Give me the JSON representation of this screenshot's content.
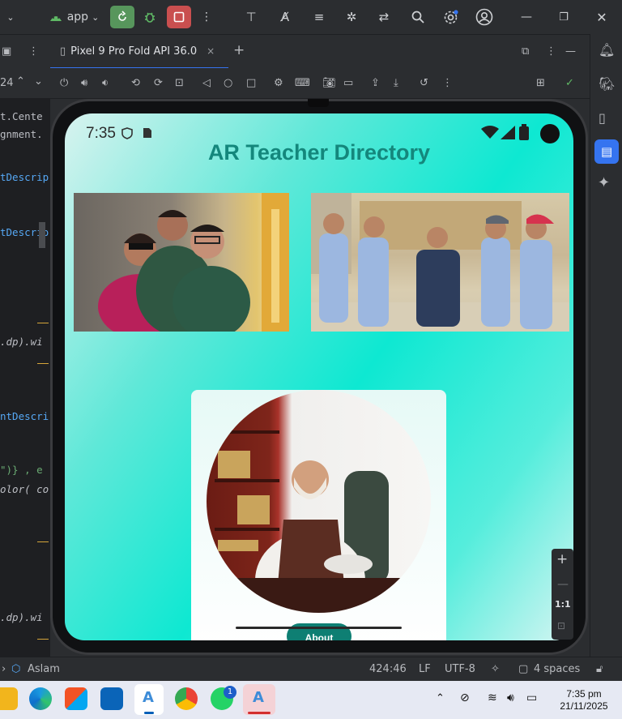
{
  "toolbar": {
    "run_config": "app",
    "icons": [
      "app-icon",
      "sync-icon",
      "debug-icon",
      "stop-icon",
      "more-icon",
      "tree-icon",
      "translate-icon",
      "logcat-icon",
      "bug-icon",
      "compare-icon",
      "search-icon",
      "settings-icon",
      "account-icon",
      "minimize-icon",
      "restore-icon",
      "close-icon"
    ]
  },
  "left_panel": {
    "zoom_value": "24"
  },
  "emulator": {
    "tab_label": "Pixel 9 Pro Fold API 36.0",
    "tab_close": "×",
    "add_tab": "+"
  },
  "code_fragments": [
    "t.Cente",
    "gnment.",
    "tDescrip",
    "tDescrip",
    ".dp).wi",
    "ntDescri",
    "\")} , e",
    "olor( co",
    ".dp).wi"
  ],
  "device": {
    "status_time": "7:35",
    "app_title": "AR Teacher Directory",
    "about_button": "About",
    "zoom_reset": "1:1",
    "zoom_in": "+"
  },
  "statusbar": {
    "project": "Aslam",
    "position": "424:46",
    "line_ending": "LF",
    "encoding": "UTF-8",
    "indent": "4 spaces"
  },
  "taskbar": {
    "time": "7:35 pm",
    "date": "21/11/2025",
    "badge_count": "1"
  },
  "colors": {
    "title": "#14877c",
    "accent": "#3574f0",
    "run_green": "#57965c",
    "stop_red": "#c94f4f"
  }
}
